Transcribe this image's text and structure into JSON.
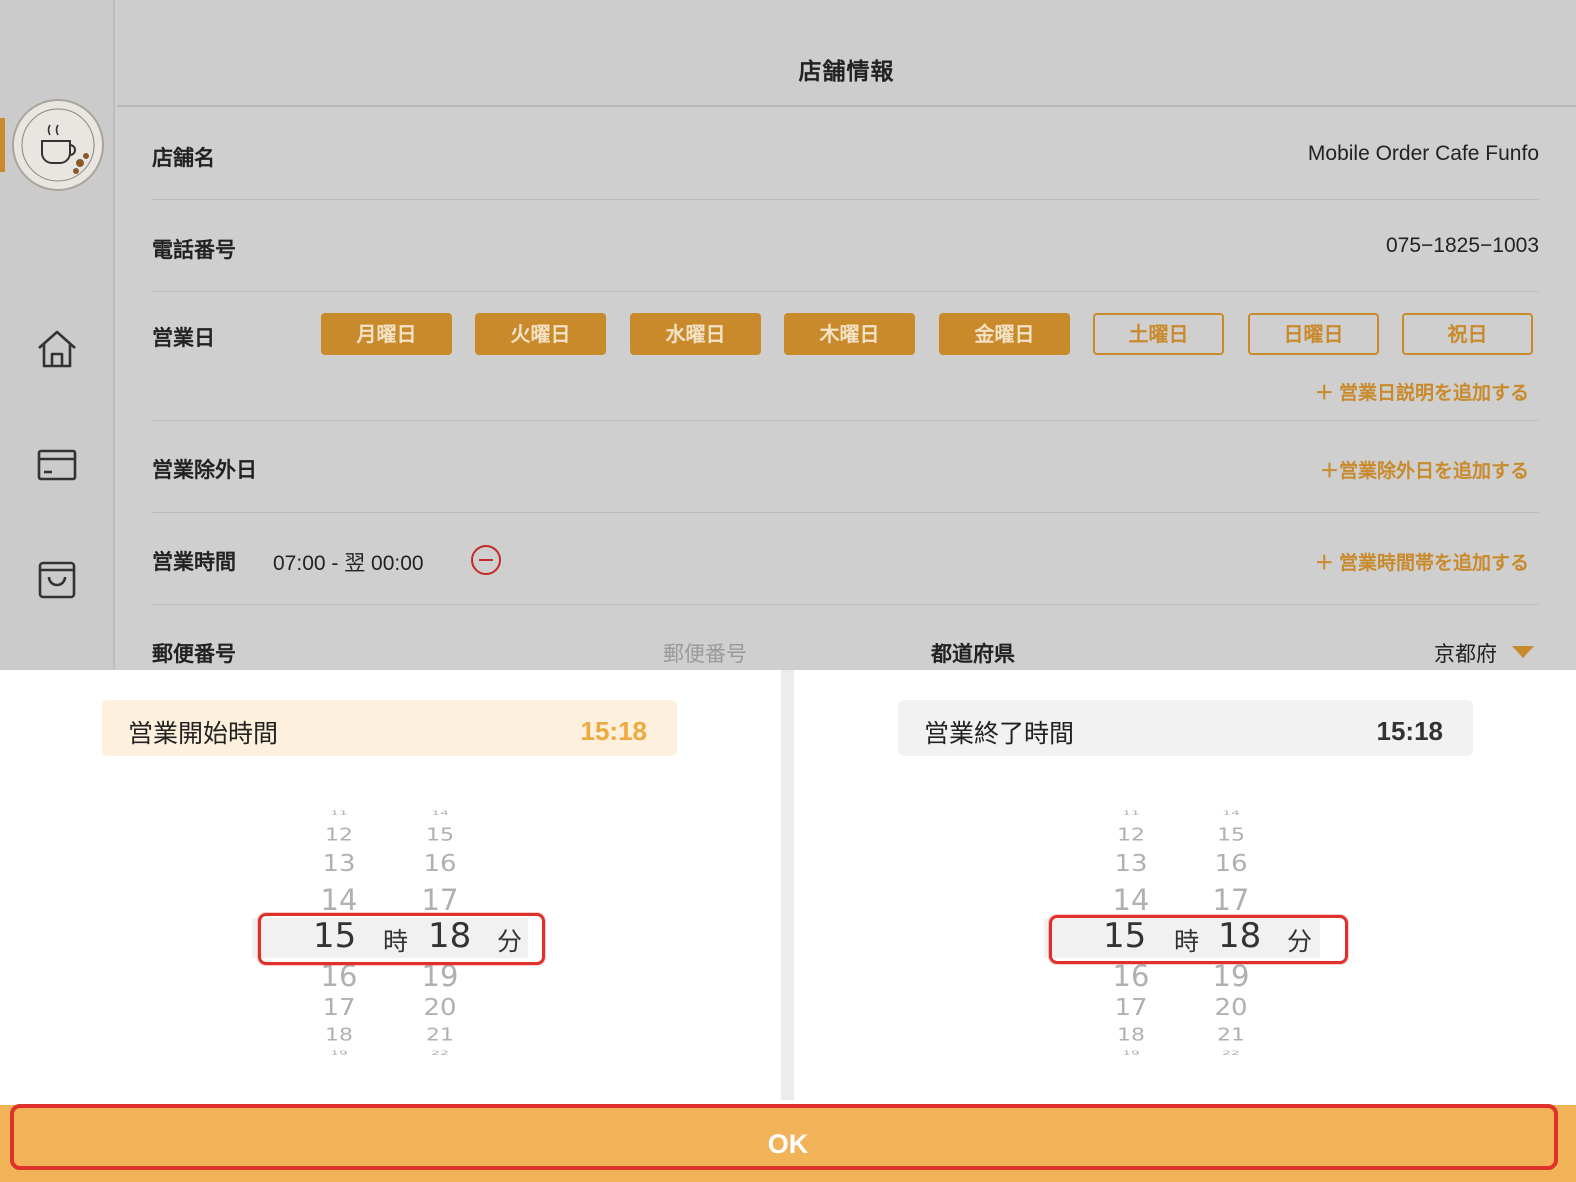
{
  "header": {
    "title": "店舗情報"
  },
  "sidebar": {
    "logo_icon": "cafe-logo-icon",
    "items": [
      {
        "icon": "home-icon"
      },
      {
        "icon": "card-icon"
      },
      {
        "icon": "bag-icon"
      }
    ]
  },
  "store": {
    "name_label": "店舗名",
    "name_value": "Mobile Order Cafe Funfo",
    "phone_label": "電話番号",
    "phone_value": "075−1825−1003",
    "days_label": "営業日",
    "days": [
      {
        "label": "月曜日",
        "selected": true
      },
      {
        "label": "火曜日",
        "selected": true
      },
      {
        "label": "水曜日",
        "selected": true
      },
      {
        "label": "木曜日",
        "selected": true
      },
      {
        "label": "金曜日",
        "selected": true
      },
      {
        "label": "土曜日",
        "selected": false
      },
      {
        "label": "日曜日",
        "selected": false
      },
      {
        "label": "祝日",
        "selected": false
      }
    ],
    "add_day_note": "＋ 営業日説明を追加する",
    "closed_label": "営業除外日",
    "add_closed": "＋営業除外日を追加する",
    "hours_label": "営業時間",
    "hours_value": "07:00 - 翌 00:00",
    "add_hours": "＋ 営業時間帯を追加する",
    "postal_label": "郵便番号",
    "postal_placeholder": "郵便番号",
    "prefecture_label": "都道府県",
    "prefecture_value": "京都府"
  },
  "picker": {
    "start": {
      "label": "営業開始時間",
      "value": "15:18",
      "hours_above": [
        "11",
        "12",
        "13",
        "14"
      ],
      "hours_below": [
        "16",
        "17",
        "18",
        "19"
      ],
      "minutes_above": [
        "14",
        "15",
        "16",
        "17"
      ],
      "minutes_below": [
        "19",
        "20",
        "21",
        "22"
      ],
      "selected_hour": "15",
      "selected_minute": "18",
      "hour_unit": "時",
      "minute_unit": "分"
    },
    "end": {
      "label": "営業終了時間",
      "value": "15:18",
      "hours_above": [
        "11",
        "12",
        "13",
        "14"
      ],
      "hours_below": [
        "16",
        "17",
        "18",
        "19"
      ],
      "minutes_above": [
        "14",
        "15",
        "16",
        "17"
      ],
      "minutes_below": [
        "19",
        "20",
        "21",
        "22"
      ],
      "selected_hour": "15",
      "selected_minute": "18",
      "hour_unit": "時",
      "minute_unit": "分"
    }
  },
  "ok_label": "OK",
  "colors": {
    "accent": "#c98a2c",
    "ok": "#f2b257",
    "highlight": "#e0302b"
  }
}
